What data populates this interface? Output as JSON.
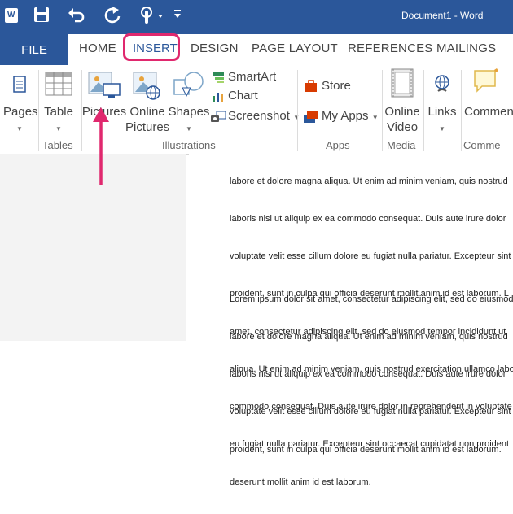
{
  "app": {
    "title": "Document1 - Word",
    "word_icon_letter": "W"
  },
  "qat": {
    "icons": [
      "word-icon",
      "save-icon",
      "undo-icon",
      "redo-icon",
      "touch-mode-icon",
      "customize-icon"
    ]
  },
  "tabs": {
    "file": "FILE",
    "home": "HOME",
    "insert": "INSERT",
    "design": "DESIGN",
    "page_layout": "PAGE LAYOUT",
    "references": "REFERENCES",
    "mailings": "MAILINGS"
  },
  "ribbon": {
    "pages": "Pages",
    "table": "Table",
    "tables_group": "Tables",
    "pictures": "Pictures",
    "online_pictures_1": "Online",
    "online_pictures_2": "Pictures",
    "shapes": "Shapes",
    "smartart": "SmartArt",
    "chart": "Chart",
    "screenshot": "Screenshot",
    "illustrations_group": "Illustrations",
    "store": "Store",
    "my_apps": "My Apps",
    "apps_group": "Apps",
    "media_group": "Media",
    "online_video_1": "Online",
    "online_video_2": "Video",
    "links": "Links",
    "comment": "Comment",
    "comments_group": "Comme"
  },
  "colors": {
    "word_blue": "#2b579a",
    "highlight_pink": "#e0286e"
  },
  "document": {
    "para1": [
      "labore et dolore magna aliqua. Ut enim ad minim veniam, quis nostrud",
      "laboris nisi ut aliquip ex ea commodo consequat. Duis aute irure dolor",
      "voluptate velit esse cillum dolore eu fugiat nulla pariatur. Excepteur sint",
      "proident, sunt in culpa qui officia deserunt mollit anim id est laborum. L",
      "amet, consectetur adipiscing elit, sed do eiusmod tempor incididunt ut",
      "aliqua. Ut enim ad minim veniam, quis nostrud exercitation ullamco labo",
      "commodo consequat. Duis aute irure dolor in reprehenderit in voluptate",
      "eu fugiat nulla pariatur. Excepteur sint occaecat cupidatat non proident",
      "deserunt mollit anim id est laborum."
    ],
    "para2": [
      "Lorem ipsum dolor sit amet, consectetur adipiscing elit, sed do eiusmod",
      "labore et dolore magna aliqua. Ut enim ad minim veniam, quis nostrud",
      "laboris nisi ut aliquip ex ea commodo consequat. Duis aute irure dolor",
      "voluptate velit esse cillum dolore eu fugiat nulla pariatur. Excepteur sint",
      "proident, sunt in culpa qui officia deserunt mollit anim id est laborum."
    ]
  }
}
